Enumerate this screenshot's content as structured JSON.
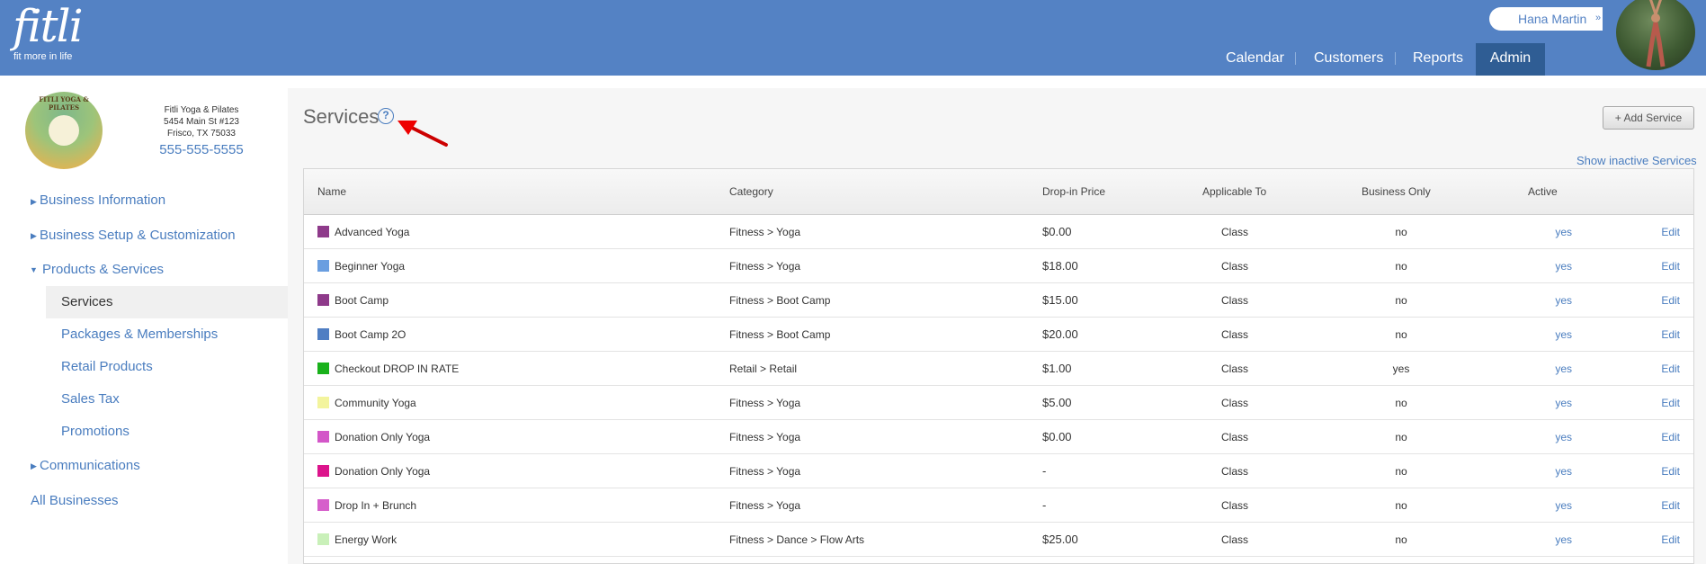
{
  "app": {
    "logo_text": "fitli",
    "tagline": "fit more in life",
    "user_name": "Hana Martin",
    "user_chevron": "»"
  },
  "nav": {
    "calendar": "Calendar",
    "customers": "Customers",
    "reports": "Reports",
    "admin": "Admin"
  },
  "business": {
    "logo_text": "FITLI YOGA & PILATES",
    "name": "Fitli Yoga & Pilates",
    "address1": "5454 Main St #123",
    "address2": "Frisco, TX 75033",
    "phone": "555-555-5555"
  },
  "sidebar": {
    "business_information": "Business Information",
    "business_setup": "Business Setup & Customization",
    "products_services": "Products & Services",
    "services": "Services",
    "packages": "Packages & Memberships",
    "retail": "Retail Products",
    "sales_tax": "Sales Tax",
    "promotions": "Promotions",
    "communications": "Communications",
    "all_businesses": "All Businesses"
  },
  "main": {
    "title": "Services",
    "help_glyph": "?",
    "add_button": "+ Add Service",
    "show_inactive": "Show inactive Services"
  },
  "table": {
    "headers": {
      "name": "Name",
      "category": "Category",
      "price": "Drop-in Price",
      "applicable": "Applicable To",
      "business_only": "Business Only",
      "active": "Active"
    },
    "rows": [
      {
        "color": "#8e3a8a",
        "name": "Advanced Yoga",
        "category": "Fitness > Yoga",
        "price": "$0.00",
        "applicable": "Class",
        "business_only": "no",
        "active": "yes",
        "edit": "Edit"
      },
      {
        "color": "#6a9ee0",
        "name": "Beginner Yoga",
        "category": "Fitness > Yoga",
        "price": "$18.00",
        "applicable": "Class",
        "business_only": "no",
        "active": "yes",
        "edit": "Edit"
      },
      {
        "color": "#8e3a8a",
        "name": "Boot Camp",
        "category": "Fitness > Boot Camp",
        "price": "$15.00",
        "applicable": "Class",
        "business_only": "no",
        "active": "yes",
        "edit": "Edit"
      },
      {
        "color": "#4f7ec3",
        "name": "Boot Camp 2O",
        "category": "Fitness > Boot Camp",
        "price": "$20.00",
        "applicable": "Class",
        "business_only": "no",
        "active": "yes",
        "edit": "Edit"
      },
      {
        "color": "#19b11b",
        "name": "Checkout DROP IN RATE",
        "category": "Retail > Retail",
        "price": "$1.00",
        "applicable": "Class",
        "business_only": "yes",
        "active": "yes",
        "edit": "Edit"
      },
      {
        "color": "#f3f49d",
        "name": "Community Yoga",
        "category": "Fitness > Yoga",
        "price": "$5.00",
        "applicable": "Class",
        "business_only": "no",
        "active": "yes",
        "edit": "Edit"
      },
      {
        "color": "#d356c8",
        "name": "Donation Only Yoga",
        "category": "Fitness > Yoga",
        "price": "$0.00",
        "applicable": "Class",
        "business_only": "no",
        "active": "yes",
        "edit": "Edit"
      },
      {
        "color": "#dc148c",
        "name": "Donation Only Yoga",
        "category": "Fitness > Yoga",
        "price": "-",
        "applicable": "Class",
        "business_only": "no",
        "active": "yes",
        "edit": "Edit"
      },
      {
        "color": "#d65fcb",
        "name": "Drop In + Brunch",
        "category": "Fitness > Yoga",
        "price": "-",
        "applicable": "Class",
        "business_only": "no",
        "active": "yes",
        "edit": "Edit"
      },
      {
        "color": "#c9f0b9",
        "name": "Energy Work",
        "category": "Fitness > Dance > Flow Arts",
        "price": "$25.00",
        "applicable": "Class",
        "business_only": "no",
        "active": "yes",
        "edit": "Edit"
      }
    ]
  }
}
